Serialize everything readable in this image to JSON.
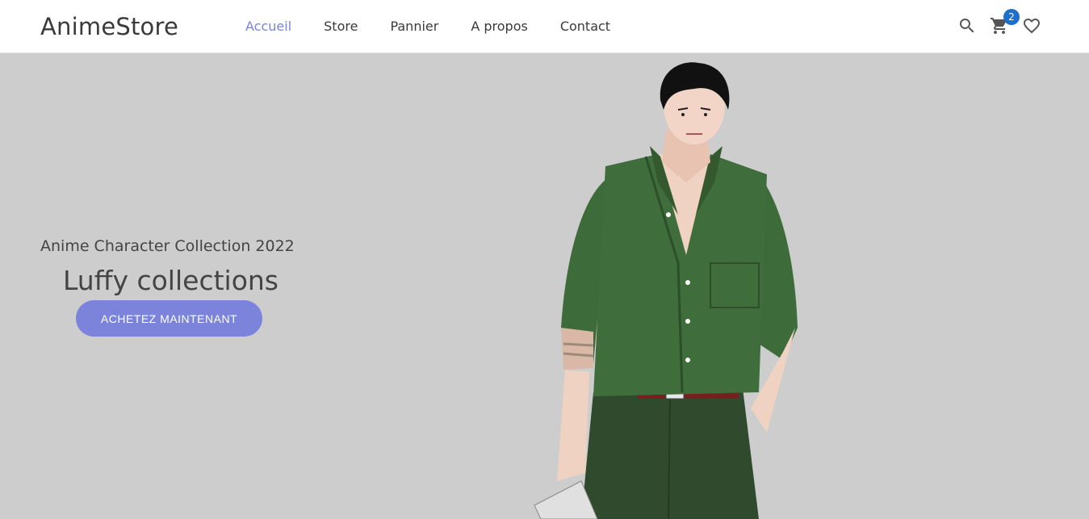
{
  "brand": {
    "name": "AnimeStore"
  },
  "nav": {
    "links": [
      {
        "label": "Accueil",
        "active": true
      },
      {
        "label": "Store",
        "active": false
      },
      {
        "label": "Pannier",
        "active": false
      },
      {
        "label": "A propos",
        "active": false
      },
      {
        "label": "Contact",
        "active": false
      }
    ],
    "active_color": "#7b84da"
  },
  "icons": {
    "search": "search-icon",
    "cart": "cart-icon",
    "favorites": "heart-icon",
    "cart_count": "2",
    "badge_color": "#1e6fcc"
  },
  "hero": {
    "subtitle": "Anime Character Collection 2022",
    "title": "Luffy collections",
    "cta_label": "ACHETEZ MAINTENANT",
    "background": "#cdcdcd",
    "cta_color": "#7b84da"
  }
}
